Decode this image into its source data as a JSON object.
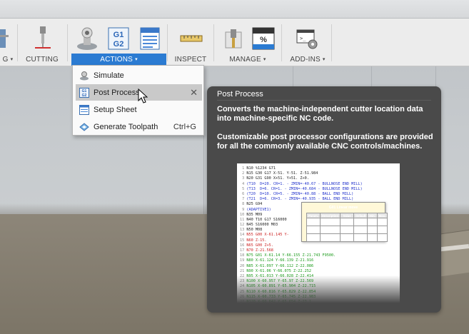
{
  "toolbar": {
    "groups": [
      {
        "label": "G",
        "has_caret": true,
        "active": false
      },
      {
        "label": "CUTTING",
        "has_caret": false,
        "active": false
      },
      {
        "label": "ACTIONS",
        "has_caret": true,
        "active": true
      },
      {
        "label": "INSPECT",
        "has_caret": false,
        "active": false
      },
      {
        "label": "MANAGE",
        "has_caret": true,
        "active": false
      },
      {
        "label": "ADD-INS",
        "has_caret": true,
        "active": false
      }
    ],
    "actions_icons": [
      "simulate-icon",
      "post-process-g1g2-icon",
      "setup-sheet-icon"
    ],
    "caret_glyph": "▾"
  },
  "menu": {
    "items": [
      {
        "label": "Simulate",
        "icon": "simulate-icon",
        "shortcut": "",
        "hover": false
      },
      {
        "label": "Post Process",
        "icon": "post-process-icon",
        "shortcut": "",
        "hover": true,
        "close": "✕"
      },
      {
        "label": "Setup Sheet",
        "icon": "setup-sheet-icon",
        "shortcut": "",
        "hover": false
      },
      {
        "label": "Generate Toolpath",
        "icon": "generate-toolpath-icon",
        "shortcut": "Ctrl+G",
        "hover": false
      }
    ]
  },
  "tooltip": {
    "title": "Post Process",
    "paragraph1": "Converts the machine-independent cutter location data into machine-specific NC code.",
    "paragraph2": "Customizable post processor configurations are provided for all the commonly available CNC controls/machines."
  },
  "nc_code": {
    "lines": [
      {
        "n": "1",
        "text": "N10 %1234 G71",
        "color": "black"
      },
      {
        "n": "2",
        "text": "N15 G30 G17 X-51. Y-51. Z-51.984",
        "color": "black"
      },
      {
        "n": "3",
        "text": "N20 G31 G90 X+51. Y+51. Z+0.",
        "color": "black"
      },
      {
        "n": "4",
        "text": "(T10  D=20. CR=1. - ZMIN=-40.67 - BULLNOSE END MILL)",
        "color": "blue"
      },
      {
        "n": "5",
        "text": "(T13  D=6. CR=1. - ZMIN=-40.684 - BULLNOSE END MILL)",
        "color": "blue"
      },
      {
        "n": "6",
        "text": "(T20  D=10. CR=5. - ZMIN=-40.88 - BALL END MILL)",
        "color": "blue"
      },
      {
        "n": "7",
        "text": "(T21  D=6. CR=3. - ZMIN=-40.935 - BALL END MILL)",
        "color": "blue"
      },
      {
        "n": "8",
        "text": "N25 G94",
        "color": "black"
      },
      {
        "n": "9",
        "text": "(ADAPTIVE1)",
        "color": "blue"
      },
      {
        "n": "10",
        "text": "N35 M09",
        "color": "black"
      },
      {
        "n": "11",
        "text": "N40 T10 G17 S16000",
        "color": "black"
      },
      {
        "n": "12",
        "text": "N45 S16000 M03",
        "color": "black"
      },
      {
        "n": "13",
        "text": "N50 M08",
        "color": "black"
      },
      {
        "n": "14",
        "text": "N55 G00 X-61.145 Y-",
        "color": "red"
      },
      {
        "n": "15",
        "text": "N60 Z-15.",
        "color": "red"
      },
      {
        "n": "16",
        "text": "N65 G00 Z+5.",
        "color": "red"
      },
      {
        "n": "17",
        "text": "N70 Z-21.568",
        "color": "red"
      },
      {
        "n": "18",
        "text": "N75 G01 X-61.14 Y-66.155 Z-21.743 F9500.",
        "color": "green"
      },
      {
        "n": "19",
        "text": "N80 X-61.124 Y-66.139 Z-21.916",
        "color": "green"
      },
      {
        "n": "20",
        "text": "N85 X-61.097 Y-66.112 Z-22.086",
        "color": "green"
      },
      {
        "n": "21",
        "text": "N90 X-61.06 Y-66.075 Z-22.252",
        "color": "green"
      },
      {
        "n": "22",
        "text": "N95 X-61.013 Y-66.028 Z-22.414",
        "color": "green"
      },
      {
        "n": "23",
        "text": "N100 X-60.957 Y-65.97 Z-22.569",
        "color": "green"
      },
      {
        "n": "24",
        "text": "N105 X-60.891 Y-65.904 Z-22.715",
        "color": "green"
      },
      {
        "n": "25",
        "text": "N110 X-60.816 Y-65.829 Z-22.854",
        "color": "green"
      },
      {
        "n": "26",
        "text": "N115 X-60.733 Y-65.745 Z-22.983",
        "color": "green"
      },
      {
        "n": "27",
        "text": "N120 X-60.642 Y-65.654 Z-23.1",
        "color": "green"
      }
    ],
    "popup": {
      "title": "G01 Linear move",
      "headers": [
        "Param.",
        "Description",
        "Value",
        "Default",
        "Min.",
        "Max."
      ],
      "rows": [
        [
          "X",
          "X coordinate",
          "-61.14",
          "",
          "",
          ""
        ],
        [
          "Y",
          "Y coordinate",
          "-66.155",
          "",
          "",
          ""
        ],
        [
          "Z",
          "Z coordinate",
          "-21.743",
          "",
          "",
          ""
        ]
      ]
    }
  },
  "colors": {
    "accent": "#2b7bd2",
    "tooltip_bg": "#4a4a4a",
    "code_blue": "#2233cc",
    "code_red": "#cc2222",
    "code_green": "#1a9a1a"
  }
}
